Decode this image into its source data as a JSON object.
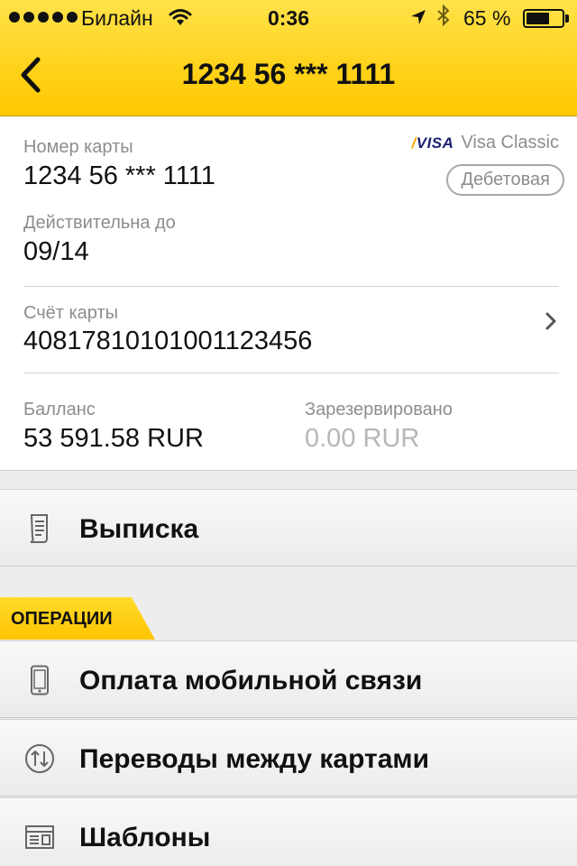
{
  "status_bar": {
    "carrier": "Билайн",
    "time": "0:36",
    "battery_percent": "65 %",
    "battery_level": 0.65,
    "signal_dots": 5
  },
  "nav": {
    "title": "1234 56 *** 1111",
    "back_icon": "chevron-left-icon"
  },
  "card": {
    "number_label": "Номер карты",
    "number_value": "1234 56 *** 1111",
    "brand_logo": "VISA",
    "brand_name": "Visa Classic",
    "type_badge": "Дебетовая",
    "expiry_label": "Действительна до",
    "expiry_value": "09/14",
    "account_label": "Счёт карты",
    "account_value": "40817810101001123456",
    "balance_label": "Балланс",
    "balance_value": "53 591.58 RUR",
    "reserved_label": "Зарезервировано",
    "reserved_value": "0.00 RUR"
  },
  "menu": {
    "statement_label": "Выписка",
    "operations_header": "ОПЕРАЦИИ",
    "operations": [
      {
        "label": "Оплата мобильной связи",
        "icon": "phone-icon"
      },
      {
        "label": "Переводы между картами",
        "icon": "transfer-icon"
      },
      {
        "label": "Шаблоны",
        "icon": "templates-icon"
      }
    ]
  },
  "colors": {
    "accent_yellow": "#ffd21a",
    "muted_text": "#8d8d8d",
    "visa_blue": "#1a1f71"
  }
}
